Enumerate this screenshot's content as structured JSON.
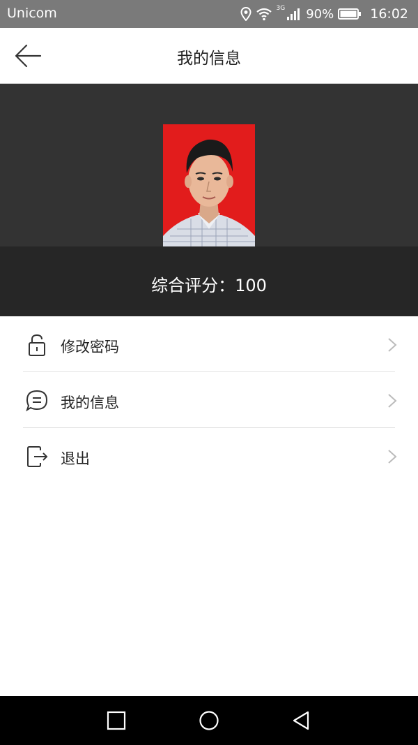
{
  "status_bar": {
    "carrier": "Unicom",
    "network_badge": "3G",
    "battery": "90%",
    "time": "16:02",
    "icons": [
      "location-icon",
      "wifi-icon",
      "signal-icon",
      "battery-icon"
    ]
  },
  "header": {
    "title": "我的信息",
    "back_icon": "back-arrow-icon"
  },
  "profile": {
    "score_text": "综合评分：100",
    "photo_background": "#e21c1c"
  },
  "menu": {
    "items": [
      {
        "label": "修改密码",
        "icon": "lock-icon"
      },
      {
        "label": "我的信息",
        "icon": "message-icon"
      },
      {
        "label": "退出",
        "icon": "logout-icon"
      }
    ]
  },
  "nav_bar": {
    "buttons": [
      "recent-apps-icon",
      "home-icon",
      "back-icon"
    ]
  },
  "colors": {
    "status_bar": "#7a7a7a",
    "profile_bg": "#333333",
    "score_bg": "#262626"
  }
}
